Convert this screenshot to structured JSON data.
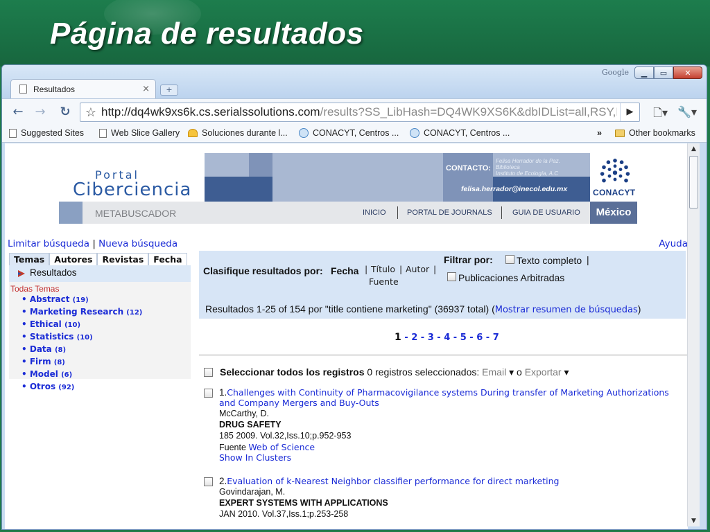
{
  "slide": {
    "title": "Página de resultados"
  },
  "browser": {
    "google_label": "Google",
    "tab_title": "Resultados",
    "tab_close": "×",
    "url_host": "http://dq4wk9xs6k.cs.serialssolutions.com",
    "url_path": "/results?SS_LibHash=DQ4WK9XS6K&dbIDList=all,RSY,BDR,JST,J",
    "bookmarks": [
      "Suggested Sites",
      "Web Slice Gallery",
      "Soluciones durante l...",
      "CONACYT, Centros ...",
      "CONACYT, Centros ..."
    ],
    "bookmarks_more": "»",
    "other_bookmarks": "Other bookmarks"
  },
  "portal": {
    "logo_top": "Portal",
    "logo_main": "Ciberciencia",
    "contact_label": "CONTACTO:",
    "contact_name": "Felisa Herrador de la Paz.",
    "contact_dept": "Biblioteca",
    "contact_inst": "Instituto de Ecología, A.C",
    "contact_email": "felisa.herrador@inecol.edu.mx",
    "conacyt": "CONACYT",
    "metabuscador": "METABUSCADOR",
    "nav": [
      "INICIO",
      "PORTAL DE JOURNALS",
      "GUIA DE USUARIO"
    ],
    "country": "México",
    "colors": {
      "dark_blue": "#3e5d92",
      "mid_blue": "#7f93b8",
      "light_blue": "#a9b8d2",
      "nav_grey": "#e5e7ea"
    }
  },
  "links": {
    "limitar": "Limitar búsqueda",
    "nueva": "Nueva búsqueda",
    "ayuda": "Ayuda"
  },
  "facets": {
    "tabs": [
      "Temas",
      "Autores",
      "Revistas",
      "Fecha"
    ],
    "results_label": "Resultados",
    "all_label": "Todas Temas",
    "items": [
      {
        "label": "Abstract",
        "count": "(19)"
      },
      {
        "label": "Marketing Research",
        "count": "(12)"
      },
      {
        "label": "Ethical",
        "count": "(10)"
      },
      {
        "label": "Statistics",
        "count": "(10)"
      },
      {
        "label": "Data",
        "count": "(8)"
      },
      {
        "label": "Firm",
        "count": "(8)"
      },
      {
        "label": "Model",
        "count": "(6)"
      },
      {
        "label": "Otros",
        "count": "(92)"
      }
    ]
  },
  "sort": {
    "label": "Clasifique resultados por:",
    "current": "Fecha",
    "options": [
      "Título",
      "Autor",
      "Fuente"
    ],
    "filter_label": "Filtrar por:",
    "filters": [
      "Texto completo",
      "Publicaciones Arbitradas"
    ],
    "summary": "Resultados 1-25 of 154 por \"title contiene marketing\" (36937 total) (",
    "summary_link": "Mostrar resumen de búsquedas",
    "summary_end": ")"
  },
  "pager": {
    "current": "1",
    "pages": [
      "2",
      "3",
      "4",
      "5",
      "6",
      "7"
    ]
  },
  "selection": {
    "select_all": "Seleccionar todos los registros",
    "count_text": "0 registros seleccionados:",
    "email": "Email",
    "or": "o",
    "export": "Exportar"
  },
  "records": [
    {
      "num": "1.",
      "title": "Challenges with Continuity of Pharmacovigilance systems During transfer of Marketing Authorizations and Company Mergers and Buy-Outs",
      "author": "McCarthy, D.",
      "journal": "DRUG SAFETY",
      "citation": "185 2009. Vol.32,Iss.10;p.952-953",
      "source_label": "Fuente",
      "source": "Web of Science",
      "clusters": "Show In Clusters"
    },
    {
      "num": "2.",
      "title": "Evaluation of k-Nearest Neighbor classifier performance for direct marketing",
      "author": "Govindarajan, M.",
      "journal": "EXPERT SYSTEMS WITH APPLICATIONS",
      "citation": "JAN 2010. Vol.37,Iss.1;p.253-258"
    }
  ]
}
